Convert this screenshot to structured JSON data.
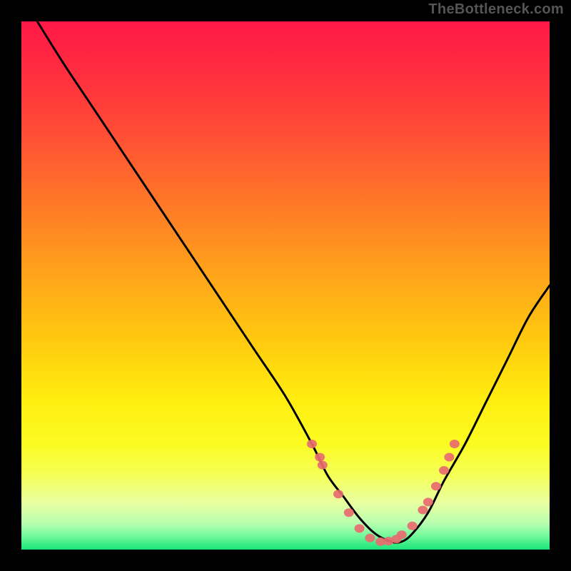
{
  "watermark": "TheBottleneck.com",
  "gradient": {
    "stops": [
      {
        "offset": 0.0,
        "color": "#ff1846"
      },
      {
        "offset": 0.1,
        "color": "#ff2e3f"
      },
      {
        "offset": 0.2,
        "color": "#ff4a36"
      },
      {
        "offset": 0.3,
        "color": "#ff6a2c"
      },
      {
        "offset": 0.4,
        "color": "#ff8a22"
      },
      {
        "offset": 0.5,
        "color": "#ffab18"
      },
      {
        "offset": 0.6,
        "color": "#ffc810"
      },
      {
        "offset": 0.65,
        "color": "#ffd90e"
      },
      {
        "offset": 0.72,
        "color": "#ffee10"
      },
      {
        "offset": 0.8,
        "color": "#fbfb22"
      },
      {
        "offset": 0.86,
        "color": "#f5ff58"
      },
      {
        "offset": 0.91,
        "color": "#eaffa0"
      },
      {
        "offset": 0.95,
        "color": "#b9ffb0"
      },
      {
        "offset": 0.975,
        "color": "#70f99a"
      },
      {
        "offset": 1.0,
        "color": "#18e57a"
      }
    ]
  },
  "chart_data": {
    "type": "line",
    "title": "",
    "xlabel": "",
    "ylabel": "",
    "xlim": [
      0,
      100
    ],
    "ylim": [
      0,
      100
    ],
    "series": [
      {
        "name": "bottleneck-curve",
        "x": [
          3,
          8,
          14,
          20,
          26,
          32,
          38,
          44,
          50,
          55,
          58,
          61,
          64,
          67,
          70,
          72,
          74,
          77,
          80,
          84,
          88,
          92,
          96,
          100
        ],
        "y": [
          100,
          92,
          83,
          74,
          65,
          56,
          47,
          38,
          29,
          20,
          14,
          10,
          6,
          3,
          1.5,
          1.5,
          3,
          7,
          13,
          20,
          28,
          36,
          44,
          50
        ]
      }
    ],
    "points": {
      "name": "highlighted-markers",
      "color": "#e86b6f",
      "x": [
        55,
        56.5,
        57,
        60,
        62,
        64,
        66,
        68,
        69.5,
        71,
        72,
        74,
        76,
        77,
        78.5,
        80,
        81,
        82
      ],
      "y": [
        20,
        17.5,
        16,
        10.5,
        7,
        4,
        2.2,
        1.5,
        1.6,
        2,
        2.8,
        4.5,
        7.5,
        9,
        12,
        15,
        17.5,
        20
      ]
    }
  }
}
